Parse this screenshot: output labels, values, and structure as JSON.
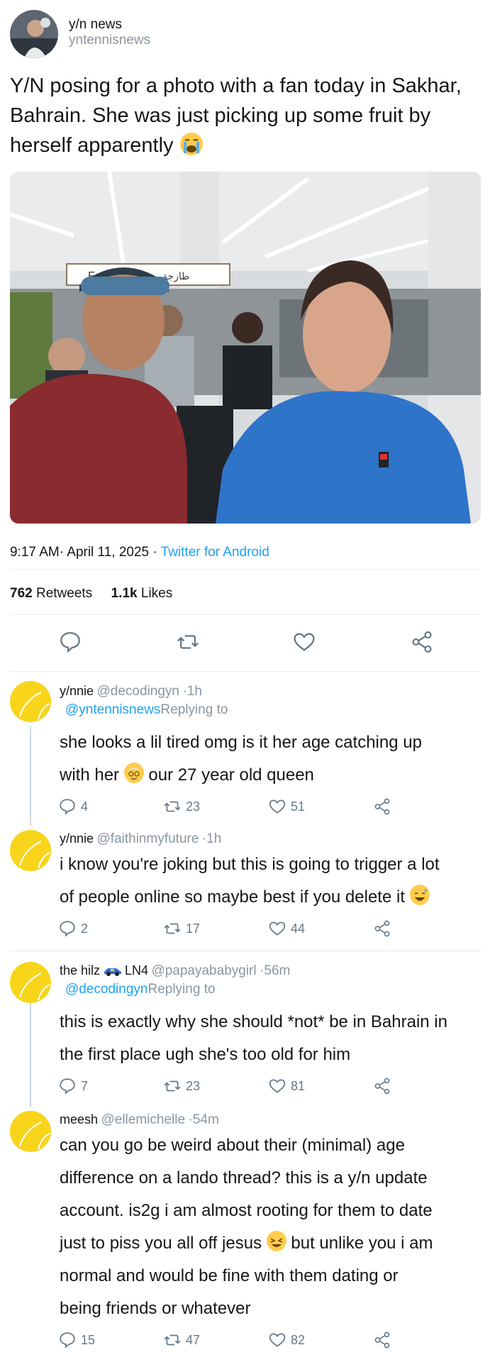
{
  "tweet": {
    "author_name": "y/n news",
    "author_handle": "yntennisnews",
    "text": "Y/N posing for a photo with a fan today in Sakhar, Bahrain. She was just picking up some fruit by herself apparently",
    "emoji": "crying-face",
    "time": "9:17 AM· April 11, 2025 · ",
    "app": "Twitter for Android",
    "photo_sign": "Food To Go",
    "photo_sign_arabic": "طازجة",
    "retweets_count": "762",
    "retweets_label": "Retweets",
    "likes_count": "1.1k",
    "likes_label": "Likes"
  },
  "replies": [
    {
      "name": "y/nnie",
      "handle": "@decodingyn",
      "time": "·1h",
      "replying_mention": "@yntennisnews",
      "replying_label": "Replying to",
      "text_lines": [
        "she looks a lil tired omg is it her age catching up",
        "with her",
        "our 27 year old queen"
      ],
      "emoji": "old-woman",
      "replies": "4",
      "retweets": "23",
      "likes": "51"
    },
    {
      "name": "y/nnie",
      "handle": "@faithinmyfuture",
      "time": "·1h",
      "text_lines": [
        "i know you're joking but this is going to trigger a lot",
        "of people online so maybe best if you delete it"
      ],
      "emoji": "grinning-sweat",
      "replies": "2",
      "retweets": "17",
      "likes": "44"
    },
    {
      "name": "the hilz",
      "name_suffix": "LN4",
      "handle": "@papayababygirl",
      "time": "·56m",
      "replying_mention": "@decodingyn",
      "replying_label": "Replying to",
      "text_lines": [
        "this is exactly why she should *not* be in Bahrain in",
        "the first place ugh she's too old for him"
      ],
      "replies": "7",
      "retweets": "23",
      "likes": "81"
    },
    {
      "name": "meesh",
      "handle": "@ellemichelle",
      "time": "·54m",
      "text_lines": [
        "can you go be weird about their (minimal) age",
        "difference on a lando thread? this is a y/n update",
        "account. is2g i am almost rooting for them to date",
        "just to piss you all off jesus",
        "but unlike you i am",
        "normal and would be fine with them dating or",
        "being friends or whatever"
      ],
      "emoji": "squinting-face",
      "replies": "15",
      "retweets": "47",
      "likes": "82"
    }
  ],
  "colors": {
    "link": "#1da1f2",
    "muted": "#8a96a1",
    "avatar": "#f8d51b",
    "divider": "#e6ecf0"
  }
}
